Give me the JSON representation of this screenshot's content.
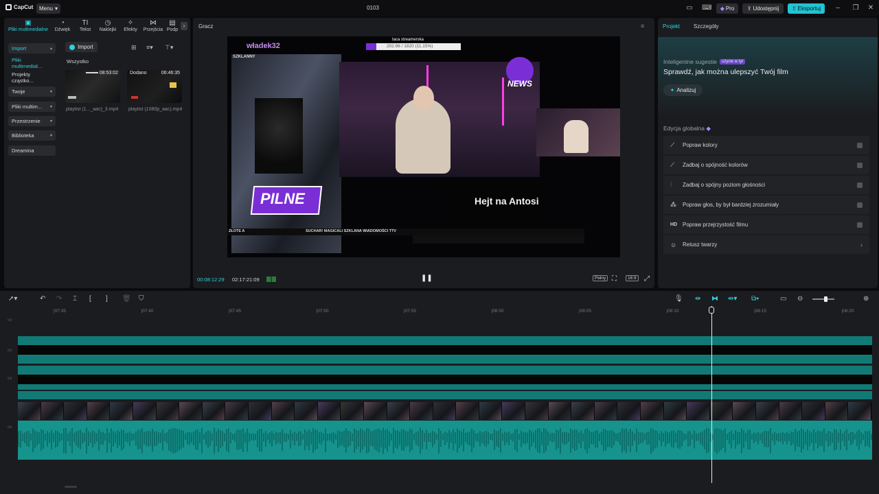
{
  "app": {
    "logo_text": "CapCut",
    "menu_label": "Menu",
    "project_title": "0103"
  },
  "header": {
    "pro_label": "Pro",
    "share_label": "Udostępnij",
    "export_label": "Eksportuj"
  },
  "left_tabs": [
    {
      "label": "Pliki multimedialne",
      "icon": "media-icon"
    },
    {
      "label": "Dźwięk",
      "icon": "audio-icon"
    },
    {
      "label": "Tekst",
      "icon": "text-icon"
    },
    {
      "label": "Naklejki",
      "icon": "sticker-icon"
    },
    {
      "label": "Efekty",
      "icon": "effects-icon"
    },
    {
      "label": "Przejścia",
      "icon": "transitions-icon"
    },
    {
      "label": "Podp",
      "icon": "captions-icon"
    }
  ],
  "sidebar": {
    "items": [
      "Import",
      "Pliki multimedial...",
      "Projekty cząstko...",
      "Twoje",
      "Pliki multim...",
      "Przestrzenie",
      "Biblioteka",
      "Dreamina"
    ]
  },
  "media": {
    "import_label": "Import",
    "filter_label": "Wszystko",
    "items": [
      {
        "duration": "08:53:02",
        "tag": "",
        "name": "playlist (1..._aac)_3.mp4"
      },
      {
        "duration": "06:46:35",
        "tag": "Dodano",
        "name": "playlist (1080p_aac).mp4"
      }
    ]
  },
  "player": {
    "title": "Gracz",
    "current_time": "00:08:12:29",
    "total_time": "02:17:21:09",
    "full_label": "Pełny",
    "ratio_label": "16:9",
    "overlay": {
      "watermark": "władek32",
      "top_title": "taca streamerska",
      "top_bar": "202.96 / 1820 (11.15%)",
      "small_label": "SZKLANNY",
      "news": "NEWS",
      "pilne": "PILNE",
      "hejt": "Hejt na Antosi",
      "ticker": "ZŁOTE A",
      "ticker2": "SUCHAR! MAGICALI SZKLANA WIADOMOŚCI TTV"
    }
  },
  "right_panel": {
    "tabs": [
      "Projekt",
      "Szczegóły"
    ],
    "suggest_label": "Inteligentne sugestie",
    "suggest_pill": "użycie w tyt",
    "suggest_title": "Sprawdź, jak można ulepszyć Twój film",
    "analyze_label": "Analizuj",
    "global_title": "Edycja globalna",
    "rows": [
      {
        "label": "Popraw kolory",
        "icon": "color-icon"
      },
      {
        "label": "Zadbaj o spójność kolorów",
        "icon": "color-match-icon"
      },
      {
        "label": "Zadbaj o spójny poziom głośności",
        "icon": "volume-icon"
      },
      {
        "label": "Popraw głos, by był bardziej zrozumiały",
        "icon": "voice-icon"
      },
      {
        "label": "Popraw przejrzystość filmu",
        "icon": "hd-icon"
      },
      {
        "label": "Retusz twarzy",
        "icon": "face-icon"
      }
    ],
    "hd_text": "HD"
  },
  "timeline": {
    "ticks": [
      "07:35",
      "07:40",
      "07:45",
      "07:50",
      "07:55",
      "08:00",
      "08:05",
      "08:10",
      "08:15",
      "08:20"
    ],
    "zoom_level": 0.6
  },
  "colors": {
    "accent": "#2fd2e0",
    "track": "#127a76",
    "clip": "#16938d"
  }
}
